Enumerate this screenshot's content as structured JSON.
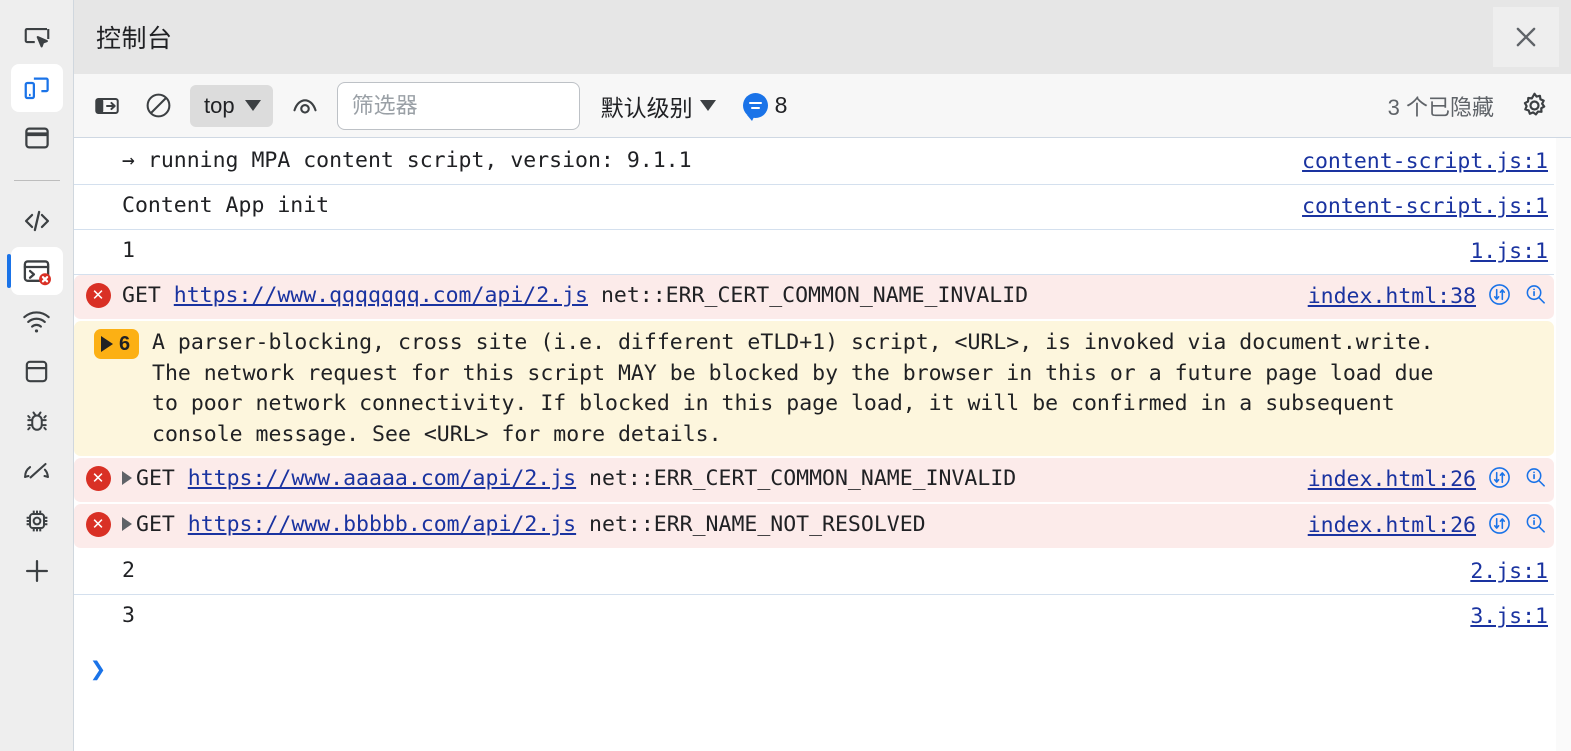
{
  "window": {
    "title": "控制台",
    "close_label": "×"
  },
  "activity_bar": {
    "items": [
      {
        "name": "inspect-element-icon",
        "label": "检查元素"
      },
      {
        "name": "device-toolbar-icon",
        "label": "设备模拟"
      },
      {
        "name": "elements-panel-icon",
        "label": "元素"
      },
      {
        "name": "sources-panel-icon",
        "label": "源代码"
      },
      {
        "name": "console-panel-icon",
        "label": "控制台"
      },
      {
        "name": "network-panel-icon",
        "label": "网络"
      },
      {
        "name": "application-panel-icon",
        "label": "应用"
      },
      {
        "name": "debugger-panel-icon",
        "label": "调试器"
      },
      {
        "name": "performance-panel-icon",
        "label": "性能"
      },
      {
        "name": "memory-panel-icon",
        "label": "内存"
      },
      {
        "name": "more-panels-icon",
        "label": "更多"
      }
    ]
  },
  "toolbar": {
    "sidebar_toggle": "显示控制台侧边栏",
    "clear_console": "清除控制台",
    "context_value": "top",
    "live_expression": "创建实时表达式",
    "filter_placeholder": "筛选器",
    "filter_value": "",
    "level_label": "默认级别",
    "message_count": "8",
    "hidden_count": "3 个已隐藏",
    "settings": "控制台设置"
  },
  "console": {
    "rows": [
      {
        "kind": "log",
        "prefix": "→ ",
        "text": "running MPA content script, version: 9.1.1",
        "source": "content-script.js:1",
        "expandable": false,
        "icons": []
      },
      {
        "kind": "log",
        "prefix": "",
        "text": "Content App init",
        "source": "content-script.js:1",
        "expandable": false,
        "icons": []
      },
      {
        "kind": "log",
        "prefix": "",
        "text": "1",
        "source": "1.js:1",
        "expandable": false,
        "icons": []
      },
      {
        "kind": "error",
        "prefix": "GET ",
        "url": "https://www.qqqqqqq.com/api/2.js",
        "text": " net::ERR_CERT_COMMON_NAME_INVALID",
        "source": "index.html:38",
        "expandable": false,
        "icons": [
          "network-request-icon",
          "inspect-issue-icon"
        ]
      },
      {
        "kind": "warning",
        "badge_count": "6",
        "text": "A parser-blocking, cross site (i.e. different eTLD+1) script, <URL>, is invoked via document.write.\nThe network request for this script MAY be blocked by the browser in this or a future page load due\nto poor network connectivity. If blocked in this page load, it will be confirmed in a subsequent\nconsole message. See <URL> for more details.",
        "source": "",
        "expandable": true,
        "icons": []
      },
      {
        "kind": "error",
        "prefix": "GET ",
        "url": "https://www.aaaaa.com/api/2.js",
        "text": " net::ERR_CERT_COMMON_NAME_INVALID",
        "source": "index.html:26",
        "expandable": true,
        "icons": [
          "network-request-icon",
          "inspect-issue-icon"
        ]
      },
      {
        "kind": "error",
        "prefix": "GET ",
        "url": "https://www.bbbbb.com/api/2.js",
        "text": " net::ERR_NAME_NOT_RESOLVED",
        "source": "index.html:26",
        "expandable": true,
        "icons": [
          "network-request-icon",
          "inspect-issue-icon"
        ]
      },
      {
        "kind": "log",
        "prefix": "",
        "text": "2",
        "source": "2.js:1",
        "expandable": false,
        "icons": []
      },
      {
        "kind": "log",
        "prefix": "",
        "text": "3",
        "source": "3.js:1",
        "expandable": false,
        "icons": []
      }
    ],
    "prompt_symbol": "❯",
    "prompt_value": ""
  },
  "colors": {
    "error_bg": "#fcebea",
    "warning_bg": "#fdf6dd",
    "error_icon": "#d93025",
    "warning_badge": "#fcb014",
    "link": "#1a33a0",
    "accent": "#1a73e8"
  }
}
